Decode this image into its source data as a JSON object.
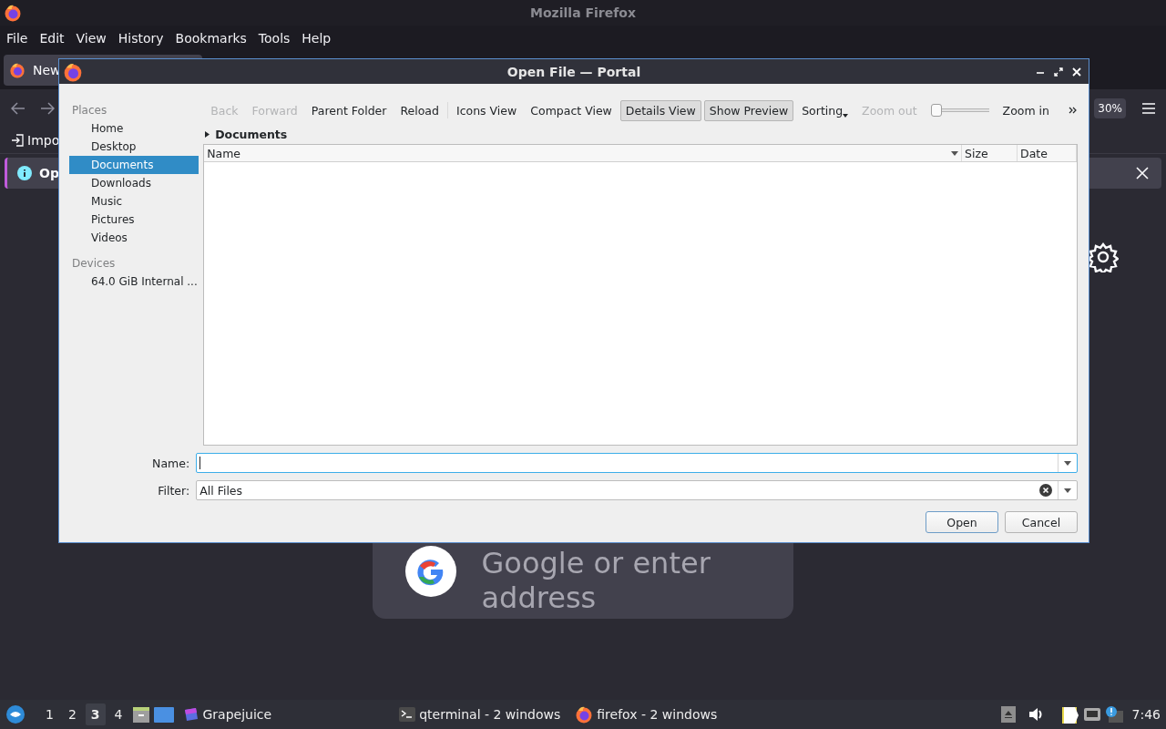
{
  "firefox": {
    "title": "Mozilla Firefox",
    "menu": [
      {
        "label": "File"
      },
      {
        "label": "Edit"
      },
      {
        "label": "View"
      },
      {
        "label": "History"
      },
      {
        "label": "Bookmarks"
      },
      {
        "label": "Tools"
      },
      {
        "label": "Help"
      }
    ],
    "tab": {
      "label": "New"
    },
    "zoom_badge": "30%",
    "bookmark": "Impo",
    "infobar": {
      "text": "Op"
    },
    "search_box": {
      "placeholder": "Google or enter address"
    }
  },
  "dialog": {
    "title": "Open File — Portal",
    "places": [
      {
        "heading": "Places",
        "items": [
          {
            "label": "Home",
            "selected": false
          },
          {
            "label": "Desktop",
            "selected": false
          },
          {
            "label": "Documents",
            "selected": true
          },
          {
            "label": "Downloads",
            "selected": false
          },
          {
            "label": "Music",
            "selected": false
          },
          {
            "label": "Pictures",
            "selected": false
          },
          {
            "label": "Videos",
            "selected": false
          }
        ]
      },
      {
        "heading": "Devices",
        "items": [
          {
            "label": "64.0 GiB Internal ...",
            "selected": false
          }
        ]
      }
    ],
    "toolbar": [
      {
        "kind": "button",
        "label": "Back",
        "disabled": true,
        "checked": false
      },
      {
        "kind": "button",
        "label": "Forward",
        "disabled": true,
        "checked": false
      },
      {
        "kind": "button",
        "label": "Parent Folder",
        "disabled": false,
        "checked": false
      },
      {
        "kind": "button",
        "label": "Reload",
        "disabled": false,
        "checked": false
      },
      {
        "kind": "separator"
      },
      {
        "kind": "button",
        "label": "Icons View",
        "disabled": false,
        "checked": false
      },
      {
        "kind": "button",
        "label": "Compact View",
        "disabled": false,
        "checked": false
      },
      {
        "kind": "button",
        "label": "Details View",
        "disabled": false,
        "checked": true
      },
      {
        "kind": "button",
        "label": "Show Preview",
        "disabled": false,
        "checked": true
      },
      {
        "kind": "menu",
        "label": "Sorting",
        "disabled": false,
        "checked": false
      },
      {
        "kind": "button",
        "label": "Zoom out",
        "disabled": true,
        "checked": false
      },
      {
        "kind": "slider",
        "level": 0
      },
      {
        "kind": "button",
        "label": "Zoom in",
        "disabled": false,
        "checked": false
      },
      {
        "kind": "more"
      }
    ],
    "location": "Documents",
    "columns": [
      "Name",
      "Size",
      "Date"
    ],
    "name_field": {
      "label": "Name:"
    },
    "filter_field": {
      "label": "Filter:",
      "value": "All Files"
    },
    "buttons": [
      {
        "label": "Open",
        "default": true
      },
      {
        "label": "Cancel",
        "default": false
      }
    ]
  },
  "taskbar": {
    "workspaces": [
      {
        "label": "1",
        "selected": false
      },
      {
        "label": "2",
        "selected": false
      },
      {
        "label": "3",
        "selected": true
      },
      {
        "label": "4",
        "selected": false
      }
    ],
    "apps": [
      {
        "label": "Grapejuice",
        "kind": "grapejuice"
      },
      {
        "label": "qterminal - 2 windows",
        "kind": "terminal"
      },
      {
        "label": "firefox - 2 windows",
        "kind": "firefox"
      }
    ],
    "clock": "7:46"
  }
}
